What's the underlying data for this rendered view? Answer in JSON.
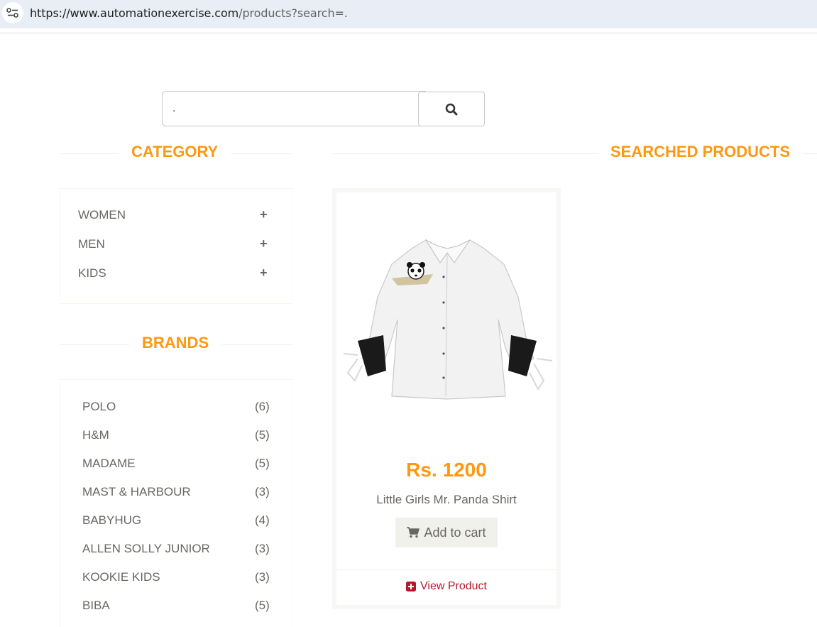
{
  "browser": {
    "url_host": "https://www.automationexercise.com",
    "url_path": "/products?search=.",
    "tune_icon": "tune-icon"
  },
  "search": {
    "value": ".",
    "button_icon": "search-icon"
  },
  "sidebar": {
    "category_title": "CATEGORY",
    "categories": [
      {
        "label": "WOMEN"
      },
      {
        "label": "MEN"
      },
      {
        "label": "KIDS"
      }
    ],
    "brands_title": "BRANDS",
    "brands": [
      {
        "name": "POLO",
        "count": "(6)"
      },
      {
        "name": "H&M",
        "count": "(5)"
      },
      {
        "name": "MADAME",
        "count": "(5)"
      },
      {
        "name": "MAST & HARBOUR",
        "count": "(3)"
      },
      {
        "name": "BABYHUG",
        "count": "(4)"
      },
      {
        "name": "ALLEN SOLLY JUNIOR",
        "count": "(3)"
      },
      {
        "name": "KOOKIE KIDS",
        "count": "(3)"
      },
      {
        "name": "BIBA",
        "count": "(5)"
      }
    ]
  },
  "main": {
    "title": "SEARCHED PRODUCTS",
    "products": [
      {
        "price": "Rs. 1200",
        "name": "Little Girls Mr. Panda Shirt",
        "add_to_cart_label": "Add to cart",
        "view_product_label": "View Product"
      }
    ]
  },
  "colors": {
    "accent": "#fe980f",
    "view_product": "#b3192d",
    "text": "#696763"
  }
}
